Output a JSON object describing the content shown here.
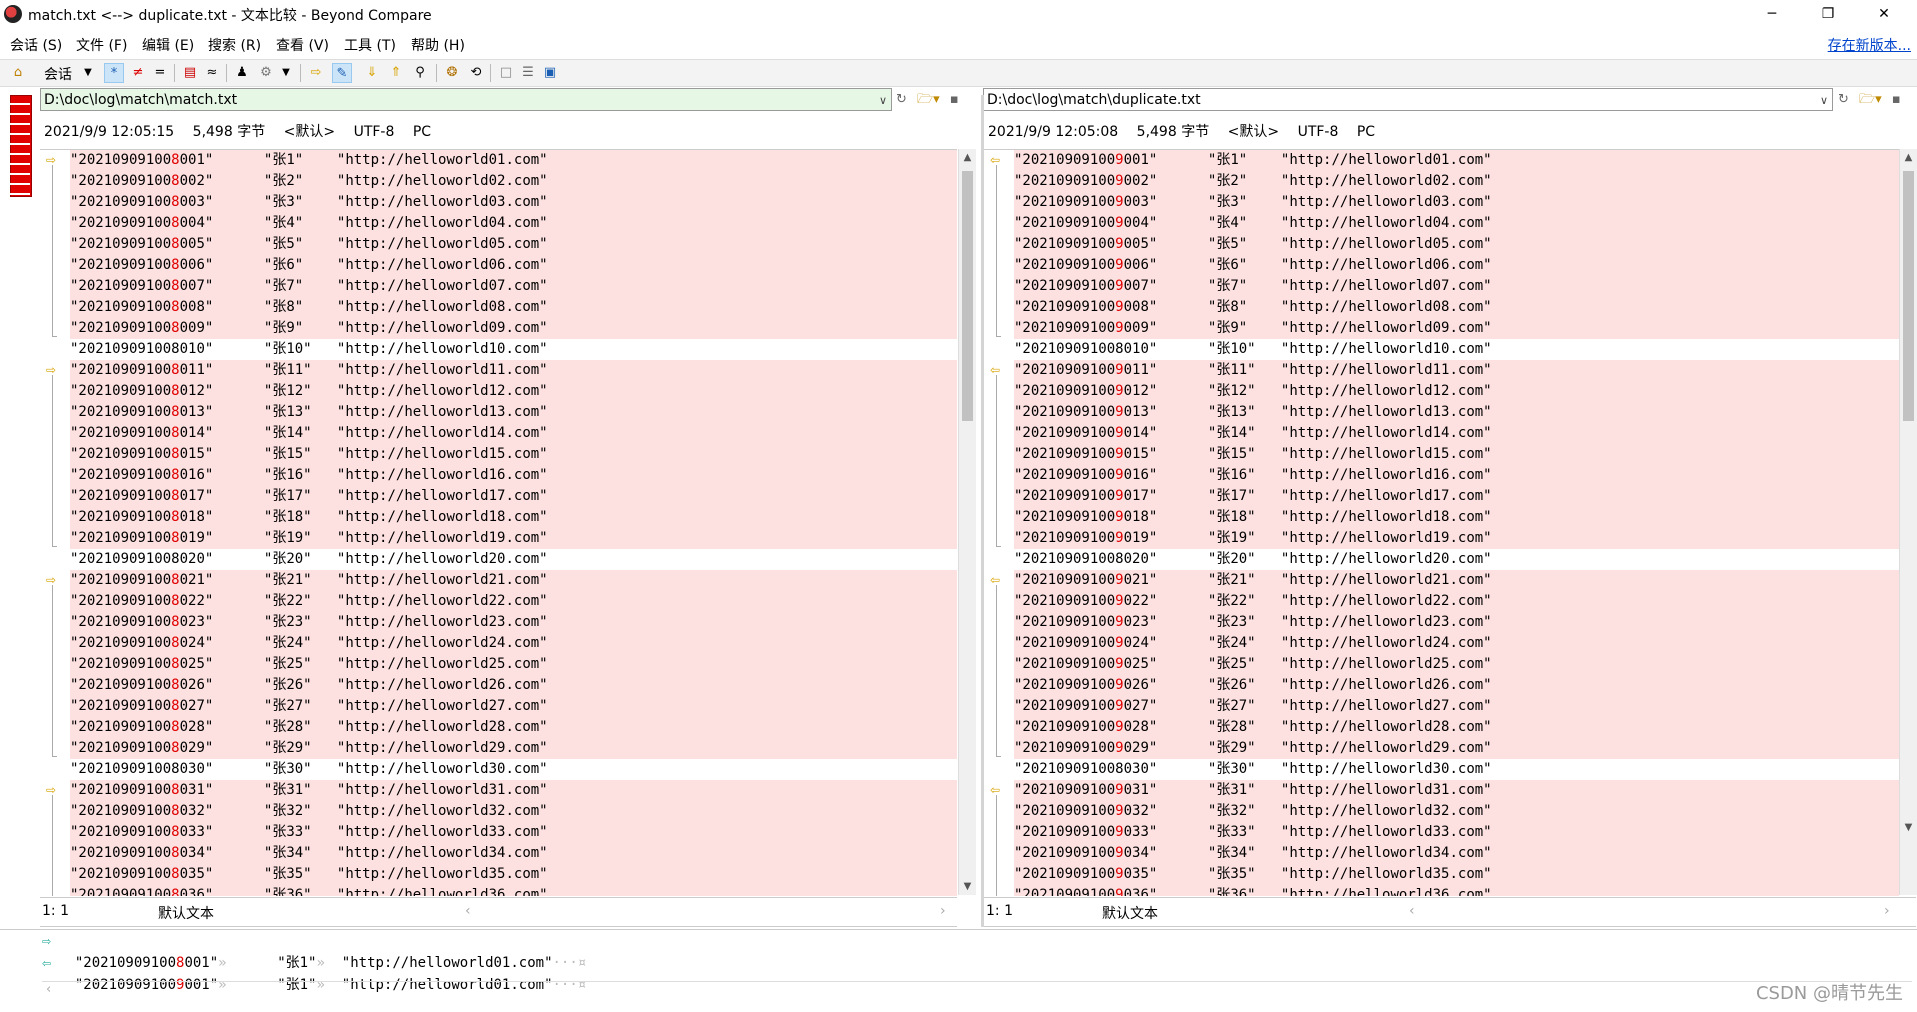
{
  "window": {
    "title": "match.txt <--> duplicate.txt - 文本比较 - Beyond Compare",
    "minimize": "─",
    "restore": "❐",
    "close": "✕"
  },
  "menu": {
    "items": [
      "会话 (S)",
      "文件 (F)",
      "编辑 (E)",
      "搜索 (R)",
      "查看 (V)",
      "工具 (T)",
      "帮助 (H)"
    ],
    "update_link": "存在新版本..."
  },
  "toolbar": {
    "session_label": "会话",
    "buttons": [
      "home-icon",
      "all-icon",
      "diffs-icon",
      "same-icon",
      "context-icon",
      "minor-icon",
      "rules-icon",
      "format-icon",
      "swap-icon",
      "edit-icon",
      "next-diff-icon",
      "prev-diff-icon",
      "find-icon",
      "copy-icon",
      "replace-icon",
      "view1-icon",
      "view2-icon",
      "view3-icon"
    ]
  },
  "left": {
    "path": "D:\\doc\\log\\match\\match.txt",
    "date": "2021/9/9 12:05:15",
    "size": "5,498 字节",
    "encoding_default": "<默认>",
    "encoding": "UTF-8",
    "line_ending": "PC",
    "status_pos": "1: 1",
    "status_format": "默认文本",
    "prefix": "20210909100",
    "diffchar": "8"
  },
  "right": {
    "path": "D:\\doc\\log\\match\\duplicate.txt",
    "date": "2021/9/9 12:05:08",
    "size": "5,498 字节",
    "encoding_default": "<默认>",
    "encoding": "UTF-8",
    "line_ending": "PC",
    "status_pos": "1: 1",
    "status_format": "默认文本",
    "prefix": "20210909100",
    "diffchar": "9"
  },
  "lines": {
    "count": 36,
    "name_prefix": "张",
    "url_prefix": "http://helloworld",
    "url_suffix": ".com"
  },
  "detail": {
    "left": [
      "\"20210909100",
      "8",
      "001\"",
      "»",
      "\"张1\"",
      "»",
      "\"http://helloworld01.com\"",
      "···¤"
    ],
    "right": [
      "\"20210909100",
      "9",
      "001\"",
      "»",
      "\"张1\"",
      "»",
      "\"http://helloworld01.com\"",
      "···¤"
    ]
  },
  "watermark": "CSDN @晴节先生"
}
